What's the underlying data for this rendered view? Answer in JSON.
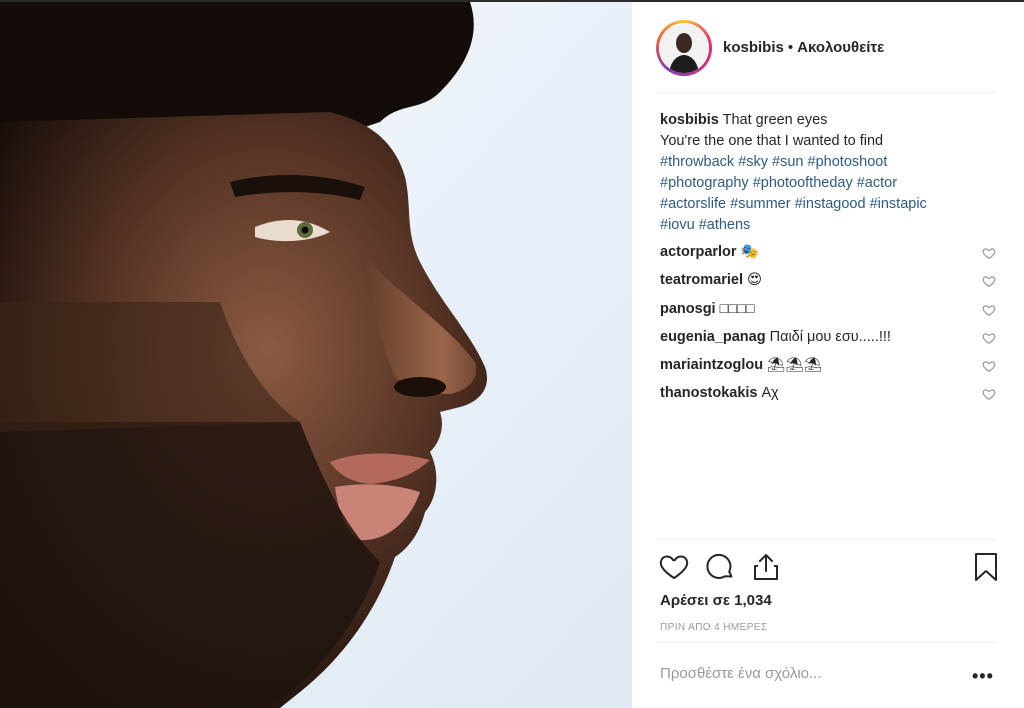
{
  "post": {
    "image_alt_icon": "profile-photo"
  },
  "header": {
    "username": "kosbibis",
    "separator": "•",
    "follow_status": "Ακολουθείτε"
  },
  "caption": {
    "username": "kosbibis",
    "line1": "That green eyes",
    "line2": "You're the one that I wanted to find",
    "hashtags": [
      "#throwback",
      "#sky",
      "#sun",
      "#photoshoot",
      "#photography",
      "#photooftheday",
      "#actor",
      "#actorslife",
      "#summer",
      "#instagood",
      "#instapic",
      "#iovu",
      "#athens"
    ]
  },
  "comments": [
    {
      "user": "actorparlor",
      "text": "🎭"
    },
    {
      "user": "teatromariel",
      "text": "😍"
    },
    {
      "user": "panosgi",
      "text": "□□□□"
    },
    {
      "user": "eugenia_panag",
      "text": "Παιδί μου εσυ.....!!!"
    },
    {
      "user": "mariaintzoglou",
      "text": "⛱⛱⛱"
    },
    {
      "user": "thanostokakis",
      "text": "Αχ"
    }
  ],
  "actions": {
    "like_icon": "heart-icon",
    "comment_icon": "comment-bubble-icon",
    "share_icon": "share-icon",
    "save_icon": "bookmark-icon"
  },
  "likes_text": "Αρέσει σε 1,034",
  "time_ago": "ΠΡΙΝ ΑΠΟ 4 ΗΜΕΡΕΣ",
  "add_comment_placeholder": "Προσθέστε ένα σχόλιο...",
  "more_label": "•••",
  "colors": {
    "hashtag": "#2f5a88",
    "text": "#262626",
    "muted": "#999999",
    "sky": "#e9f1f9"
  }
}
